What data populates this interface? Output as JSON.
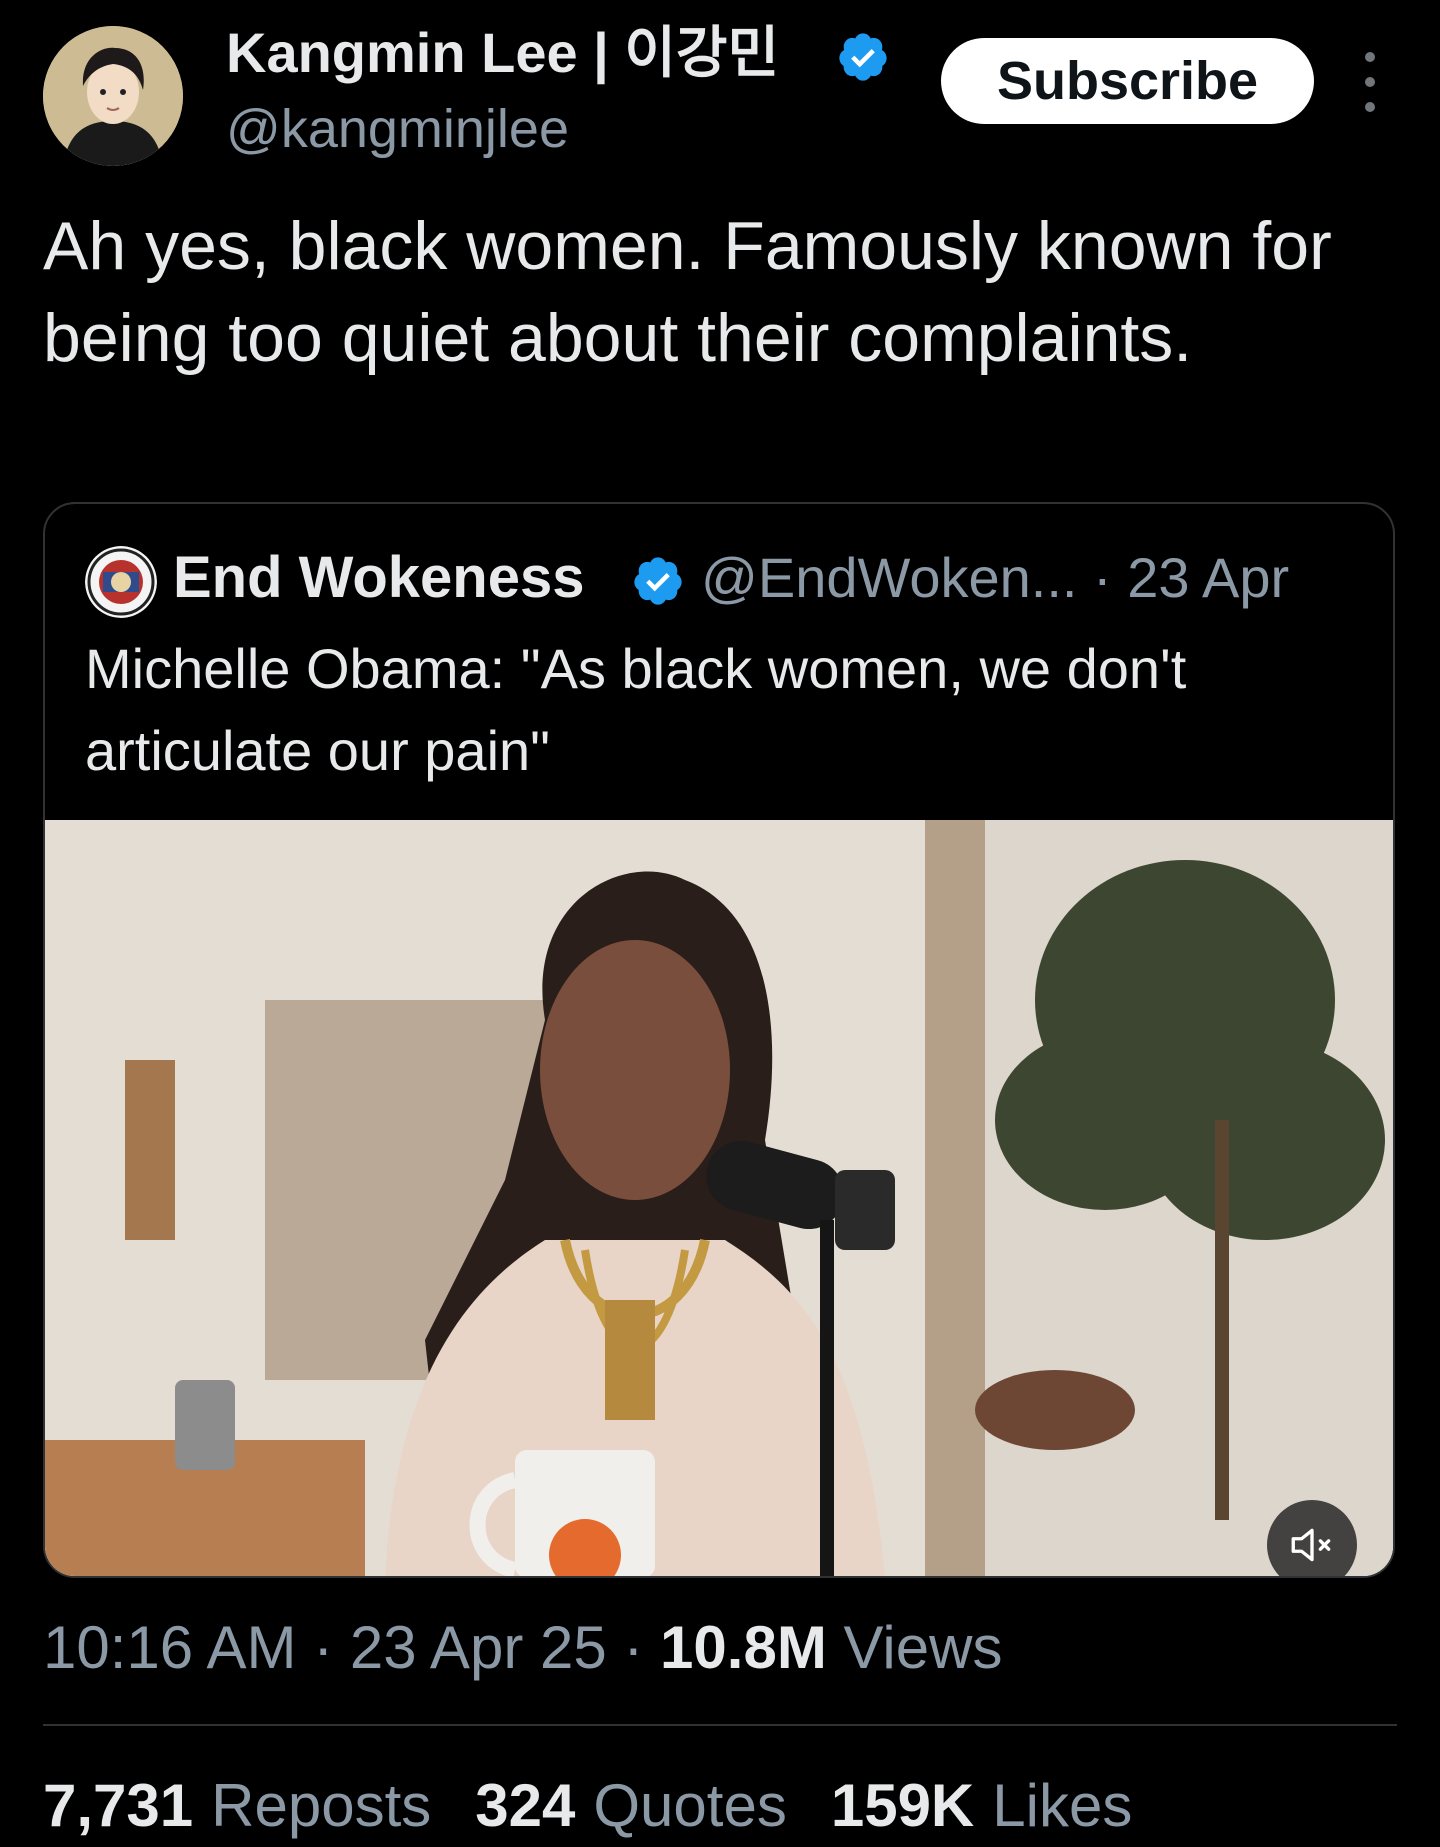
{
  "author": {
    "name": "Kangmin Lee | 이강민",
    "handle": "@kangminjlee",
    "verified": true
  },
  "actions": {
    "subscribe_label": "Subscribe"
  },
  "tweet": {
    "text": "Ah yes, black women. Famously known for being too quiet about their complaints."
  },
  "quoted": {
    "name": "End Wokeness",
    "handle": "@EndWoken...",
    "date": "· 23 Apr",
    "text": "Michelle Obama: \"As black women, we don't articulate our pain\""
  },
  "meta": {
    "time": "10:16 AM",
    "date": "· 23 Apr 25 ·",
    "views_count": "10.8M",
    "views_label": "Views"
  },
  "stats": {
    "reposts_count": "7,731",
    "reposts_label": "Reposts",
    "quotes_count": "324",
    "quotes_label": "Quotes",
    "likes_count": "159K",
    "likes_label": "Likes"
  },
  "colors": {
    "background": "#000000",
    "text_primary": "#e7e9ea",
    "text_secondary": "#8b98a5",
    "verified_blue": "#1d9bf0",
    "divider": "#2f3336"
  },
  "icons": {
    "verified": "verified-badge-icon",
    "more": "more-options-icon",
    "mute": "muted-speaker-icon"
  }
}
